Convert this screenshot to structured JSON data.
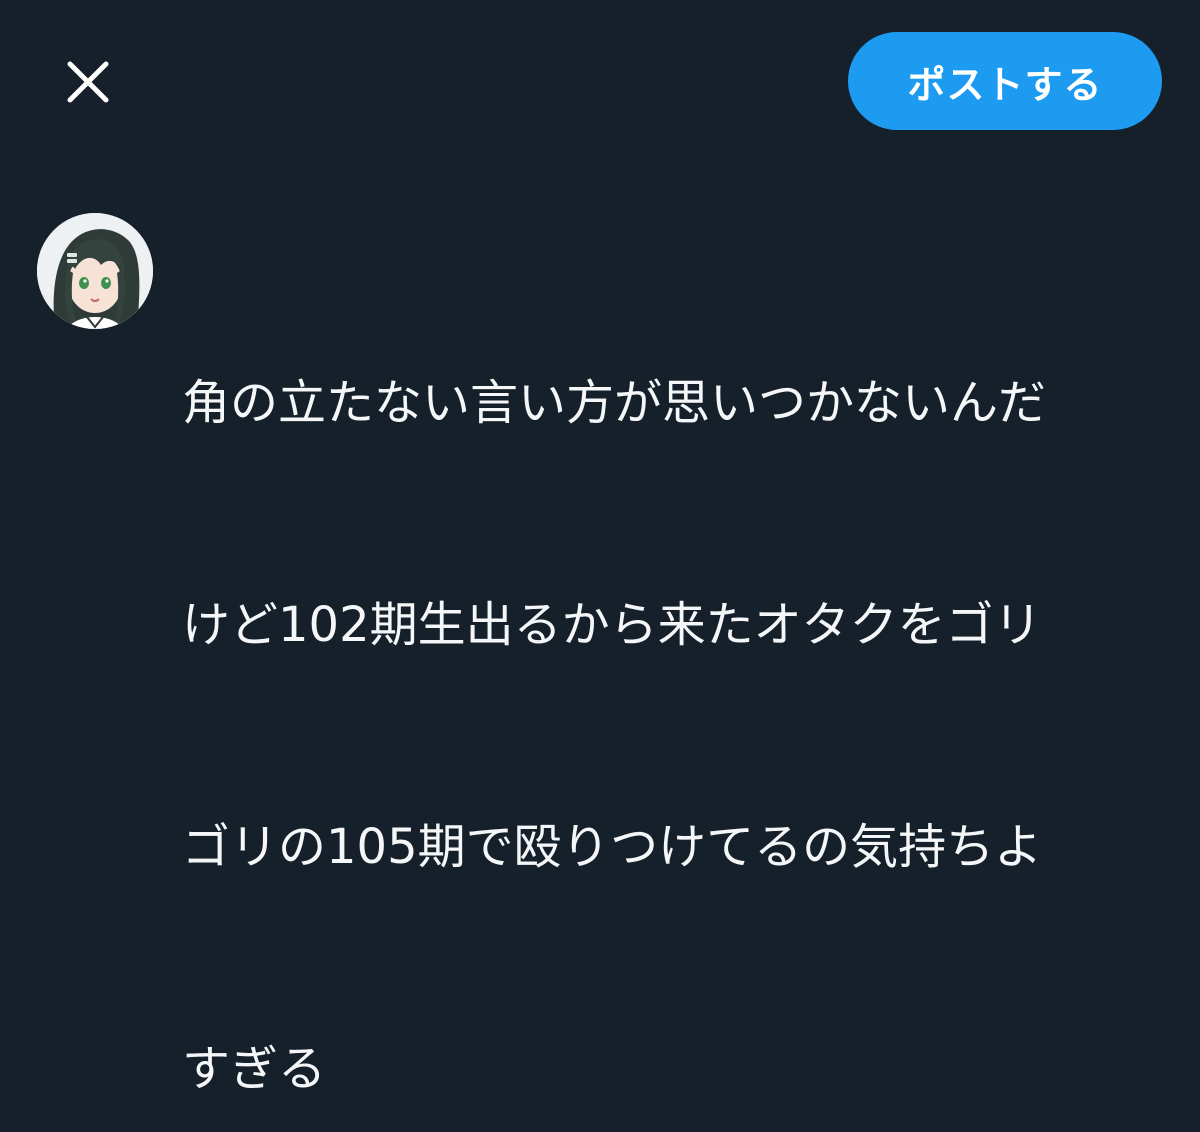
{
  "header": {
    "close_icon": "close-icon",
    "post_label": "ポストする"
  },
  "colors": {
    "background": "#15202b",
    "accent": "#1d9bf0",
    "text": "#f4f6f8"
  },
  "composer": {
    "avatar_icon": "user-avatar",
    "text_lines": [
      "角の立たない言い方が思いつかないんだ",
      "けど102期生出るから来たオタクをゴリ",
      "ゴリの105期で殴りつけてるの気持ちよ",
      "すぎる"
    ]
  }
}
